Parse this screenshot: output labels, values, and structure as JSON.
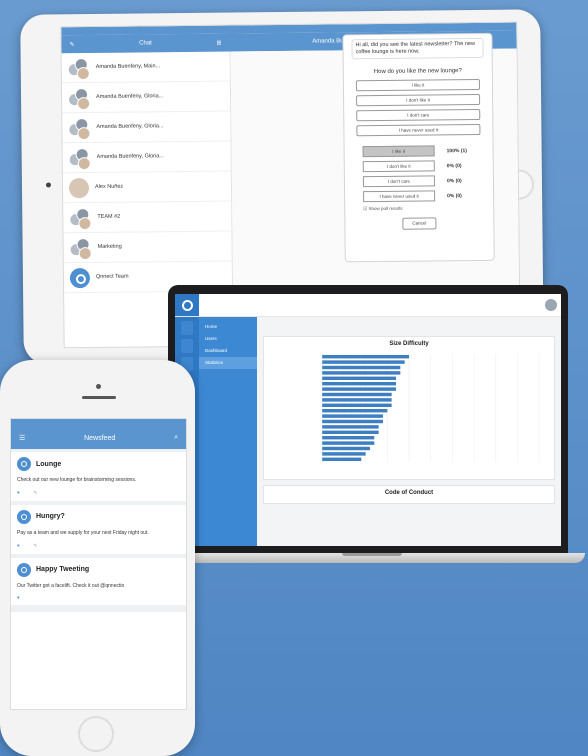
{
  "tablet": {
    "status": {
      "left": "",
      "center": "",
      "right": ""
    },
    "nav": {
      "left_title": "Chat",
      "right_title": "Amanda Buenfeny, Gloria Wood, Juan Barber"
    },
    "chats": [
      {
        "type": "group",
        "name": "Amanda Buenfeny, Main...",
        "time": "",
        "preview": ""
      },
      {
        "type": "group",
        "name": "Amanda Buenfeny, Gloria...",
        "time": "",
        "preview": ""
      },
      {
        "type": "group",
        "name": "Amanda Buenfeny, Gloria...",
        "time": "",
        "preview": ""
      },
      {
        "type": "group",
        "name": "Amanda Buenfeny, Gloria...",
        "time": "",
        "preview": ""
      },
      {
        "type": "single",
        "name": "Alex Nuñez",
        "time": "",
        "preview": ""
      },
      {
        "type": "group",
        "name": "TEAM #2",
        "time": "",
        "preview": ""
      },
      {
        "type": "group",
        "name": "Marketing",
        "time": "",
        "preview": ""
      },
      {
        "type": "logo",
        "name": "Qnnect Team",
        "time": "",
        "preview": ""
      }
    ],
    "poll": {
      "message": "Hi all, did you see the latest newsletter? The new coffee lounge is here now.",
      "question": "How do you like the new lounge?",
      "options": [
        "I like it",
        "I don't like it",
        "I don't care",
        "I have never used it"
      ],
      "results": [
        {
          "label": "I like it",
          "pct": "100% (1)",
          "selected": true
        },
        {
          "label": "I don't like it",
          "pct": "0% (0)",
          "selected": false
        },
        {
          "label": "I don't care",
          "pct": "0% (0)",
          "selected": false
        },
        {
          "label": "I have never used it",
          "pct": "0% (0)",
          "selected": false
        }
      ],
      "checkbox": "Show poll results",
      "cancel": "Cancel"
    },
    "date_label": ""
  },
  "laptop": {
    "header": {
      "title_line1": "",
      "title_line2": "",
      "stat": "",
      "user": ""
    },
    "sidebar": [
      {
        "label": "Home",
        "active": false
      },
      {
        "label": "Users",
        "active": false
      },
      {
        "label": "Dashboard",
        "active": false
      },
      {
        "label": "Statistics",
        "active": true
      }
    ],
    "filters": [
      "",
      "",
      ""
    ],
    "chart_card": {
      "title": "Size Difficulty",
      "subtitle": ""
    },
    "chart_data": {
      "type": "bar",
      "orientation": "horizontal",
      "title": "Size Difficulty",
      "categories": [
        "",
        "",
        "",
        "",
        "",
        "",
        "",
        "",
        "",
        "",
        "",
        "",
        "",
        "",
        "",
        "",
        "",
        "",
        "",
        ""
      ],
      "values": [
        20,
        19,
        18,
        18,
        17,
        17,
        17,
        16,
        16,
        16,
        15,
        14,
        14,
        13,
        13,
        12,
        12,
        11,
        10,
        9
      ],
      "xlim": [
        0,
        50
      ],
      "grid": true
    },
    "second_card": {
      "title": "Code of Conduct",
      "subtitle": ""
    }
  },
  "phone": {
    "nav_title": "Newsfeed",
    "posts": [
      {
        "title": "Lounge",
        "body": "Check out our new lounge for brainstorming sessions.",
        "actions": [
          "",
          ""
        ]
      },
      {
        "title": "Hungry?",
        "body": "Pay as a team and we supply for your next Friday night out.",
        "actions": [
          "",
          ""
        ]
      },
      {
        "title": "Happy Tweeting",
        "body": "Our Twitter got a facelift. Check it out @qnnectio",
        "actions": [
          ""
        ]
      }
    ]
  }
}
